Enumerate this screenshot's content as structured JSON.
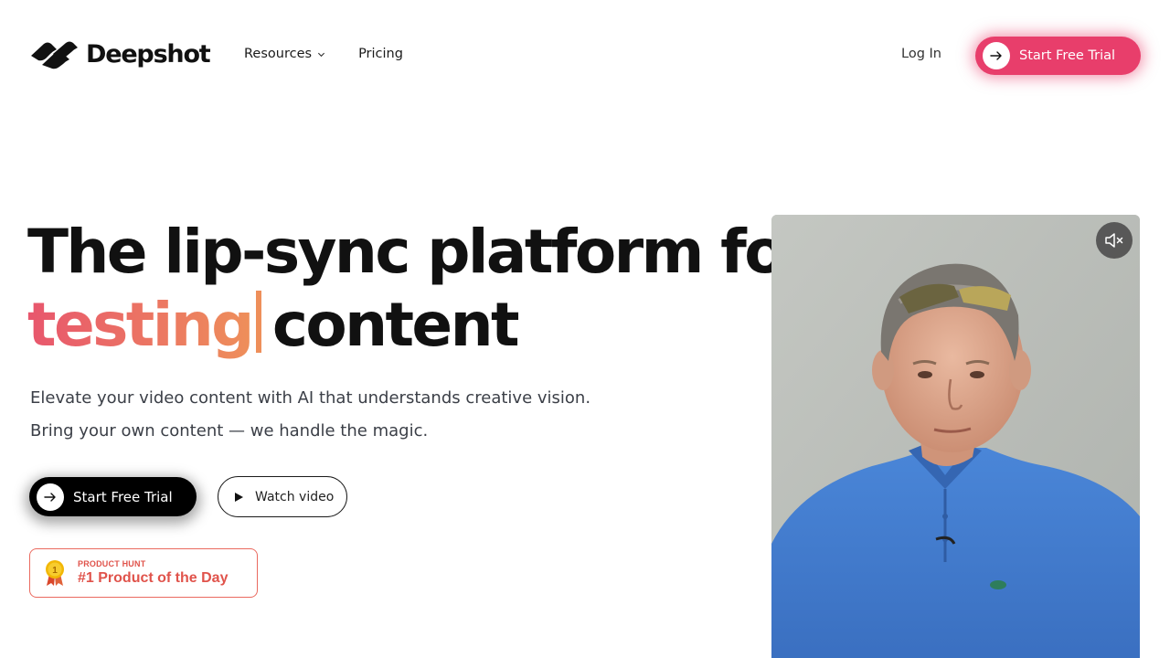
{
  "brand": {
    "name": "Deepshot"
  },
  "nav": {
    "links": [
      {
        "label": "Resources",
        "has_dropdown": true
      },
      {
        "label": "Pricing",
        "has_dropdown": false
      }
    ],
    "login_label": "Log In",
    "cta_label": "Start Free Trial"
  },
  "hero": {
    "headline_line1": "The lip-sync platform for",
    "headline_typed_word": "testing",
    "headline_line2_rest": "content",
    "subtitle_line1": "Elevate your video content with AI that understands creative vision.",
    "subtitle_line2": "Bring your own content — we handle the magic.",
    "primary_cta_label": "Start Free Trial",
    "secondary_cta_label": "Watch video"
  },
  "badge": {
    "kicker": "PRODUCT HUNT",
    "title": "#1 Product of the Day",
    "medal_number": "1"
  },
  "video": {
    "muted": true,
    "mute_icon": "speaker-muted-icon"
  },
  "colors": {
    "accent_pink": "#e83e6b",
    "gradient_start": "#e8566d",
    "gradient_end": "#ee8f5a",
    "badge_red": "#e0534b",
    "text_dark": "#111111"
  }
}
